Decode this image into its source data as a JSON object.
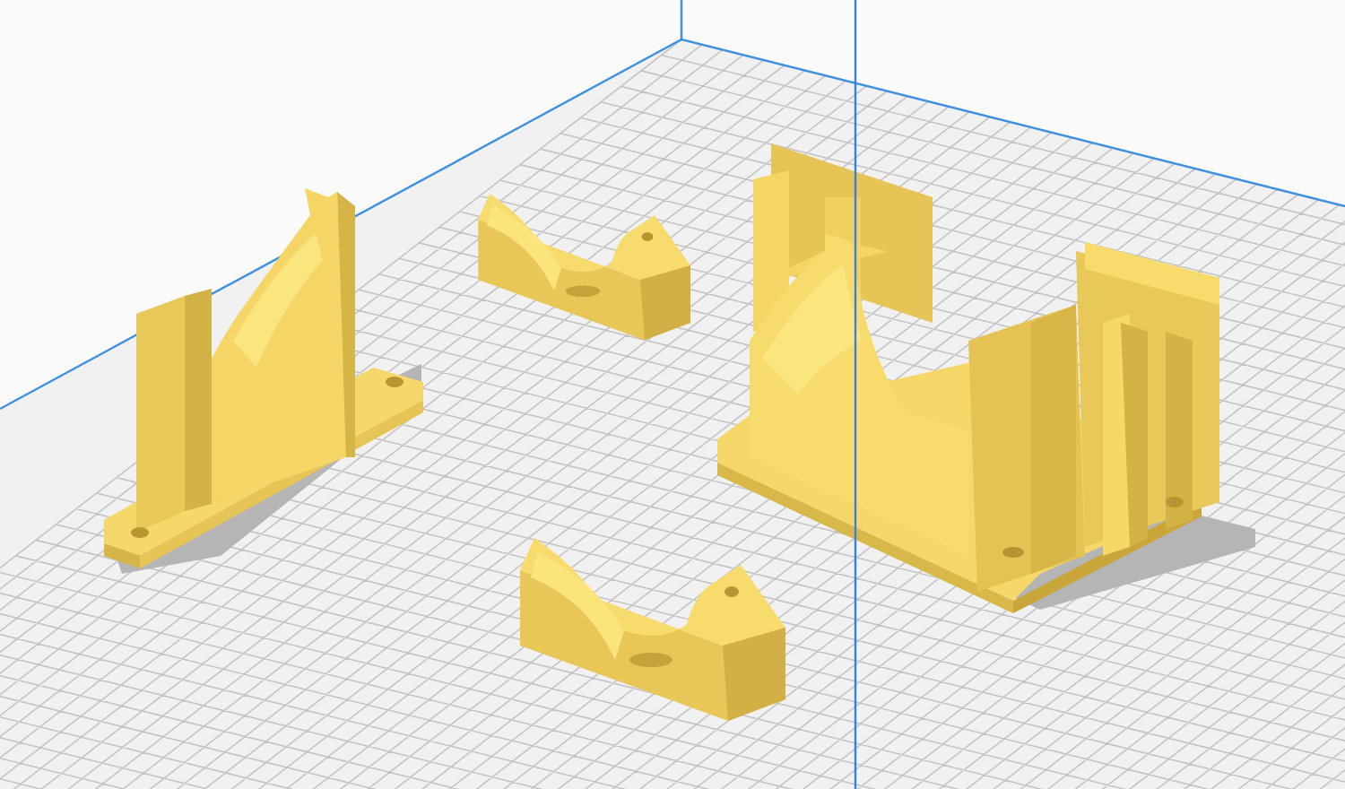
{
  "viewport": {
    "parts": [
      {
        "kind": "bracket"
      },
      {
        "kind": "clamp"
      },
      {
        "kind": "twin-bracket"
      },
      {
        "kind": "clamp"
      }
    ]
  }
}
